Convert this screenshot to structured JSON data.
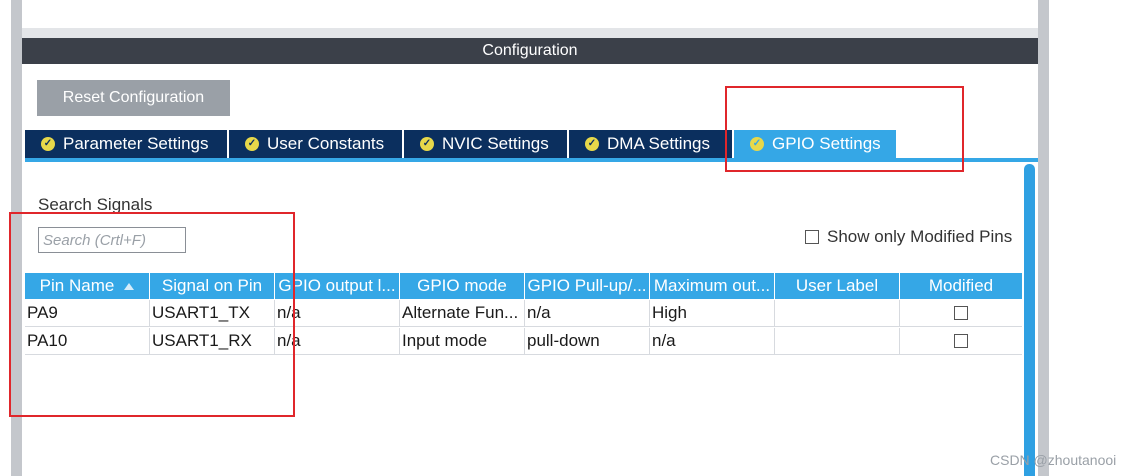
{
  "config": {
    "title": "Configuration"
  },
  "reset_button": {
    "label": "Reset Configuration"
  },
  "tabs": [
    {
      "label": "Parameter Settings",
      "active": false
    },
    {
      "label": "User Constants",
      "active": false
    },
    {
      "label": "NVIC Settings",
      "active": false
    },
    {
      "label": "DMA Settings",
      "active": false
    },
    {
      "label": "GPIO Settings",
      "active": true
    }
  ],
  "search": {
    "label": "Search Signals",
    "placeholder": "Search (Crtl+F)",
    "value": ""
  },
  "show_modified": {
    "label": "Show only Modified Pins",
    "checked": false
  },
  "table": {
    "columns": [
      "Pin Name",
      "Signal on Pin",
      "GPIO output l...",
      "GPIO mode",
      "GPIO Pull-up/...",
      "Maximum out...",
      "User Label",
      "Modified"
    ],
    "rows": [
      {
        "pin": "PA9",
        "signal": "USART1_TX",
        "output": "n/a",
        "mode": "Alternate Fun...",
        "pull": "n/a",
        "max": "High",
        "label": "",
        "modified": false
      },
      {
        "pin": "PA10",
        "signal": "USART1_RX",
        "output": "n/a",
        "mode": "Input mode",
        "pull": "pull-down",
        "max": "n/a",
        "label": "",
        "modified": false
      }
    ]
  },
  "watermark": "CSDN @zhoutanooi",
  "colors": {
    "header_dark": "#3b4049",
    "tab_dark": "#0b2f5e",
    "tab_active": "#35a7e6",
    "annotation_red": "#e0262b"
  }
}
